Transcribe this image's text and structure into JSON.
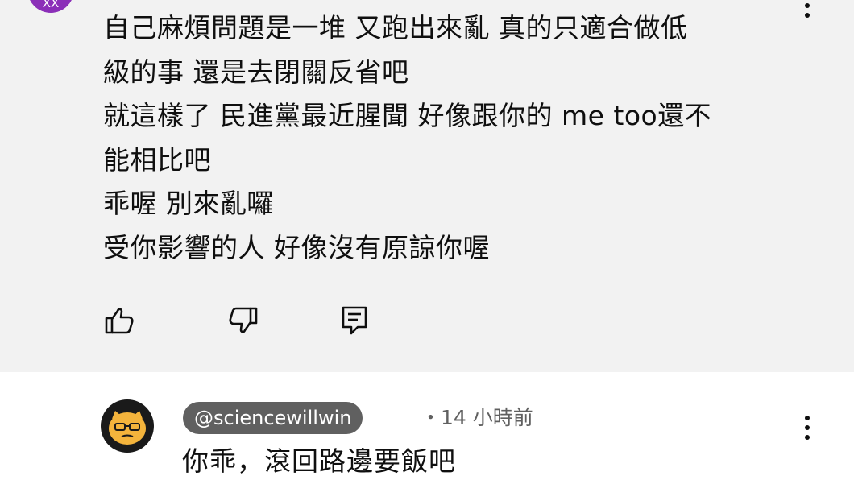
{
  "comment": {
    "avatar_text": "XX",
    "lines": [
      "自己麻煩問題是一堆 又跑出來亂 真的只適合做低",
      "級的事 還是去閉關反省吧",
      "就這樣了 民進黨最近腥聞 好像跟你的 me too還不",
      "能相比吧",
      "乖喔 別來亂囉",
      "受你影響的人 好像沒有原諒你喔"
    ],
    "actions": {
      "like_icon": "thumbs-up-icon",
      "dislike_icon": "thumbs-down-icon",
      "reply_icon": "reply-icon"
    },
    "menu_icon": "more-vert-icon"
  },
  "reply": {
    "handle": "@sciencewillwin",
    "time": "・14 小時前",
    "text": "你乖，滾回路邊要飯吧",
    "menu_icon": "more-vert-icon",
    "avatar_colors": {
      "background": "#1a1a1a",
      "face": "#f4b43c"
    }
  },
  "colors": {
    "highlight_background": "#f2f2f2",
    "avatar_purple": "#8b2fb8",
    "handle_pill": "#606060",
    "secondary_text": "#606060"
  }
}
